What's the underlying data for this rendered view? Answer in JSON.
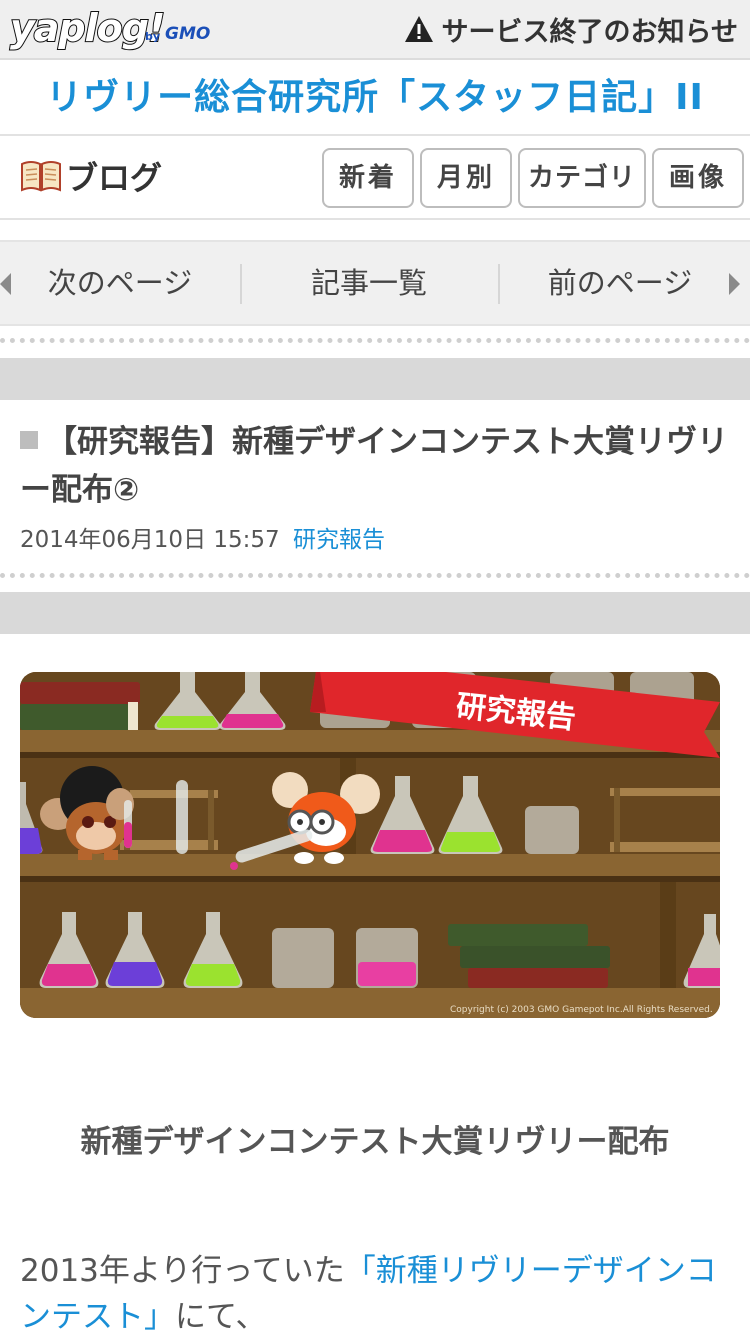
{
  "header": {
    "logo_text": "yaplog!",
    "logo_by": "by",
    "logo_gmo": "GMO",
    "notice_label": "サービス終了のお知らせ"
  },
  "blog": {
    "title": "リヴリー総合研究所「スタッフ日記」II",
    "section_label": "ブログ",
    "tabs": [
      {
        "label": "新着"
      },
      {
        "label": "月別"
      },
      {
        "label": "カテゴリ"
      },
      {
        "label": "画像"
      }
    ]
  },
  "pager": {
    "next_label": "次のページ",
    "list_label": "記事一覧",
    "prev_label": "前のページ"
  },
  "article": {
    "title": "【研究報告】新種デザインコンテスト大賞リヴリー配布②",
    "date": "2014年06月10日 15:57",
    "category": "研究報告",
    "banner_label": "研究報告",
    "copyright": "Copyright (c) 2003 GMO Gamepot Inc.All Rights Reserved.",
    "subheading": "新種デザインコンテスト大賞リヴリー配布",
    "body_prefix": "2013年より行っていた",
    "body_link": "「新種リヴリーデザインコンテスト」",
    "body_suffix": "にて、"
  },
  "colors": {
    "accent": "#1a8fd6",
    "banner_red": "#e0262b",
    "shelf": "#6b4a22"
  }
}
